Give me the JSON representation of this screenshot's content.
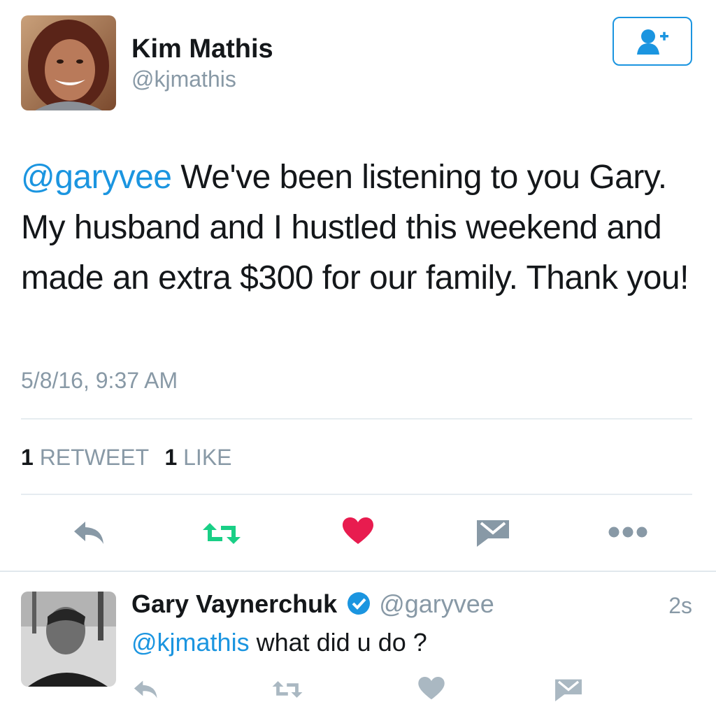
{
  "tweet": {
    "author": {
      "name": "Kim Mathis",
      "handle": "@kjmathis"
    },
    "mention": "@garyvee",
    "text": " We've been listening to you Gary. My husband and I hustled this weekend and made an extra $300 for our family. Thank you!",
    "timestamp": "5/8/16, 9:37 AM",
    "stats": {
      "retweet_count": "1",
      "retweet_label": "RETWEET",
      "like_count": "1",
      "like_label": "LIKE"
    },
    "actions": [
      "reply-icon",
      "retweet-icon",
      "heart-icon",
      "message-icon",
      "more-icon"
    ],
    "colors": {
      "retweet": "#19cf86",
      "like": "#e81c4f",
      "link": "#1b95e0",
      "muted": "#8899a6"
    }
  },
  "reply": {
    "author": {
      "name": "Gary Vaynerchuk",
      "handle": "@garyvee",
      "verified_icon": "verified-badge-icon"
    },
    "time": "2s",
    "mention": "@kjmathis",
    "text": " what did u do ?",
    "actions": [
      "reply-icon",
      "retweet-icon",
      "heart-icon",
      "message-icon"
    ]
  },
  "follow_button_icon": "add-user-icon"
}
